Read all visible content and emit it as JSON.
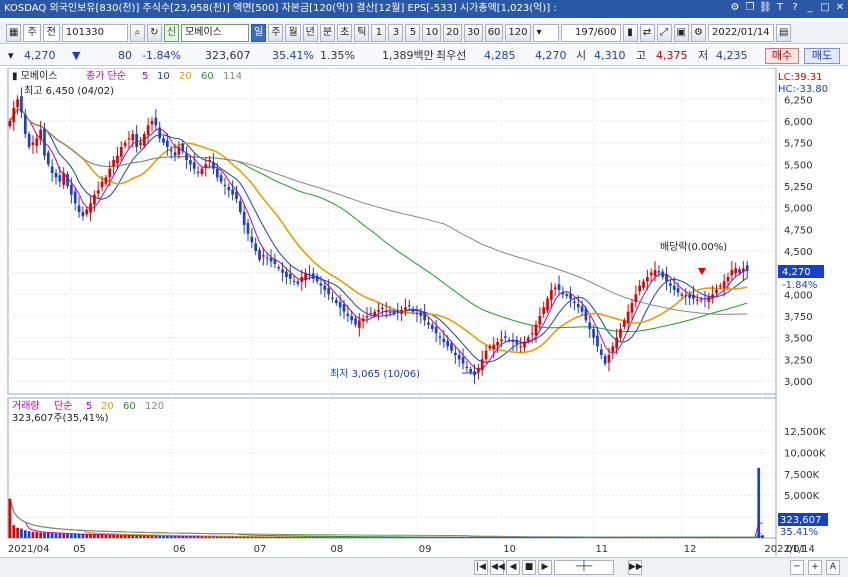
{
  "window": {
    "title": "KOSDAQ 외국인보유[830(천)] 주식수[23,958(천)] 액면[500] 자본금[120(억)] 결산[12월] EPS[-533] 시가총액[1,023(억)] :"
  },
  "toolbar": {
    "market": "주",
    "type": "전",
    "code": "101330",
    "market_badge": "신",
    "stock_name": "모베이스",
    "periods": [
      "일",
      "주",
      "월",
      "년",
      "분",
      "초",
      "틱"
    ],
    "active_period": "일",
    "intervals": [
      "1",
      "3",
      "5",
      "10",
      "20",
      "30",
      "60",
      "120"
    ],
    "count": "197/600",
    "date": "2022/01/14"
  },
  "quote": {
    "price": "4,270",
    "change_arrow": "▼",
    "change": "80",
    "change_pct": "-1.84%",
    "volume": "323,607",
    "volume_pct": "35.41%",
    "turnover": "1.35%",
    "amount": "1,389백만",
    "best_label": "최우선",
    "best_ask": "4,285",
    "best_bid": "4,270",
    "open_label": "시",
    "open": "4,310",
    "high_label": "고",
    "high": "4,375",
    "low_label": "저",
    "low": "4,235",
    "buy_label": "매수",
    "sell_label": "매도"
  },
  "price_panel": {
    "name": "모베이스",
    "legend_prefix": "종가 단순",
    "ma_labels": [
      "5",
      "10",
      "20",
      "60",
      "114"
    ],
    "ma_colors": [
      "#c000c0",
      "#1a3fcf",
      "#e6a100",
      "#1f9a2a",
      "#888888"
    ],
    "lc": "LC:39.31",
    "hc": "HC:-33.80",
    "high_note": "최고 6,450 (04/02)",
    "low_note": "최저 3,065 (10/06)",
    "dividend_note": "배당락(0.00%)",
    "current_price_label": "4,270",
    "current_change_label": "-1.84%",
    "current_volume_label": "4,000"
  },
  "volume_panel": {
    "legend_prefix": "거래량",
    "legend_type": "단순",
    "ma_labels": [
      "5",
      "20",
      "60",
      "120"
    ],
    "ma_colors": [
      "#c000c0",
      "#e6a100",
      "#1f9a2a",
      "#888888"
    ],
    "volume_note": "323,607주(35,41%)",
    "current_volume_label": "323,607",
    "current_pct_label": "35.41%"
  },
  "chart_data": {
    "type": "candlestick",
    "y_ticks": [
      "6,250",
      "6,000",
      "5,750",
      "5,500",
      "5,250",
      "5,000",
      "4,750",
      "4,500",
      "4,250",
      "4,000",
      "3,750",
      "3,500",
      "3,250",
      "3,000"
    ],
    "y_values": [
      6250,
      6000,
      5750,
      5500,
      5250,
      5000,
      4750,
      4500,
      4250,
      4000,
      3750,
      3500,
      3250,
      3000
    ],
    "ylim": [
      2850,
      6450
    ],
    "volume_ticks": [
      "12,500K",
      "10,000K",
      "7,500K",
      "5,000K",
      "2,500K"
    ],
    "volume_values": [
      12500,
      10000,
      7500,
      5000,
      2500
    ],
    "volume_ylim": [
      0,
      14500
    ],
    "x_labels": [
      "2021/04",
      "05",
      "06",
      "07",
      "08",
      "09",
      "10",
      "11",
      "12",
      "2022/01",
      "01/14"
    ],
    "x_index": [
      0,
      17,
      43,
      64,
      84,
      107,
      129,
      153,
      176,
      197,
      220
    ],
    "n_days": 197,
    "closes": [
      6000,
      6150,
      6250,
      6100,
      5850,
      5700,
      5750,
      5800,
      5900,
      5600,
      5500,
      5400,
      5350,
      5300,
      5400,
      5250,
      5150,
      5050,
      4950,
      4900,
      4980,
      5050,
      5150,
      5200,
      5300,
      5350,
      5450,
      5550,
      5600,
      5700,
      5750,
      5800,
      5850,
      5700,
      5750,
      5850,
      5950,
      6000,
      5950,
      5800,
      5750,
      5700,
      5650,
      5600,
      5700,
      5650,
      5550,
      5500,
      5450,
      5400,
      5450,
      5500,
      5550,
      5450,
      5350,
      5300,
      5250,
      5200,
      5150,
      5100,
      4950,
      4800,
      4700,
      4600,
      4500,
      4400,
      4450,
      4420,
      4380,
      4350,
      4300,
      4250,
      4200,
      4180,
      4150,
      4120,
      4200,
      4250,
      4230,
      4180,
      4150,
      4100,
      4050,
      4000,
      3950,
      3900,
      3850,
      3800,
      3750,
      3700,
      3650,
      3700,
      3720,
      3750,
      3780,
      3800,
      3820,
      3830,
      3810,
      3790,
      3780,
      3800,
      3820,
      3850,
      3870,
      3800,
      3780,
      3750,
      3700,
      3650,
      3600,
      3550,
      3500,
      3450,
      3400,
      3350,
      3300,
      3250,
      3200,
      3150,
      3100,
      3065,
      3150,
      3250,
      3350,
      3400,
      3420,
      3450,
      3480,
      3500,
      3470,
      3450,
      3430,
      3400,
      3450,
      3500,
      3550,
      3650,
      3750,
      3850,
      3950,
      4050,
      4080,
      4050,
      4000,
      3980,
      3950,
      3900,
      3850,
      3800,
      3700,
      3600,
      3500,
      3400,
      3300,
      3200,
      3300,
      3400,
      3500,
      3600,
      3700,
      3800,
      3900,
      4000,
      4100,
      4150,
      4200,
      4250,
      4280,
      4250,
      4200,
      4150,
      4100,
      4050,
      4020,
      4000,
      3980,
      3960,
      3950,
      3940,
      3930,
      3950,
      3970,
      4000,
      4050,
      4100,
      4150,
      4200,
      4280,
      4300,
      4250,
      4300,
      4270
    ],
    "volumes": [
      4600,
      1500,
      1200,
      1100,
      900,
      800,
      700,
      700,
      650,
      620,
      600,
      580,
      550,
      520,
      500,
      480,
      470,
      460,
      450,
      440,
      430,
      420,
      410,
      400,
      390,
      380,
      370,
      360,
      350,
      340,
      330,
      320,
      310,
      300,
      300,
      290,
      280,
      270,
      260,
      250,
      250,
      240,
      230,
      220,
      210,
      210,
      200,
      200,
      190,
      190,
      180,
      180,
      170,
      170,
      160,
      160,
      160,
      150,
      150,
      150,
      140,
      140,
      140,
      130,
      130,
      130,
      130,
      120,
      120,
      120,
      120,
      110,
      110,
      110,
      110,
      100,
      100,
      100,
      100,
      100,
      100,
      95,
      95,
      95,
      90,
      90,
      90,
      90,
      85,
      85,
      85,
      85,
      80,
      80,
      80,
      80,
      80,
      80,
      80,
      80,
      80,
      80,
      80,
      80,
      80,
      80,
      80,
      80,
      80,
      80,
      80,
      80,
      80,
      80,
      80,
      80,
      80,
      80,
      80,
      80,
      80,
      80,
      80,
      80,
      80,
      80,
      80,
      80,
      80,
      80,
      80,
      80,
      80,
      80,
      80,
      80,
      80,
      80,
      80,
      80,
      80,
      80,
      80,
      80,
      80,
      80,
      80,
      80,
      80,
      80,
      80,
      80,
      80,
      80,
      80,
      80,
      80,
      80,
      80,
      80,
      80,
      80,
      80,
      80,
      80,
      80,
      80,
      80,
      80,
      80,
      80,
      80,
      80,
      80,
      80,
      80,
      80,
      80,
      80,
      80,
      80,
      80,
      80,
      80,
      80,
      80,
      80,
      80,
      80,
      80,
      80,
      80,
      80,
      80,
      80,
      8200,
      324
    ]
  },
  "bottom": {
    "buttons": [
      "|◀",
      "◀◀",
      "◀",
      "■",
      "▶",
      "▶▶"
    ],
    "right_buttons": [
      "─",
      "+",
      "A"
    ]
  }
}
